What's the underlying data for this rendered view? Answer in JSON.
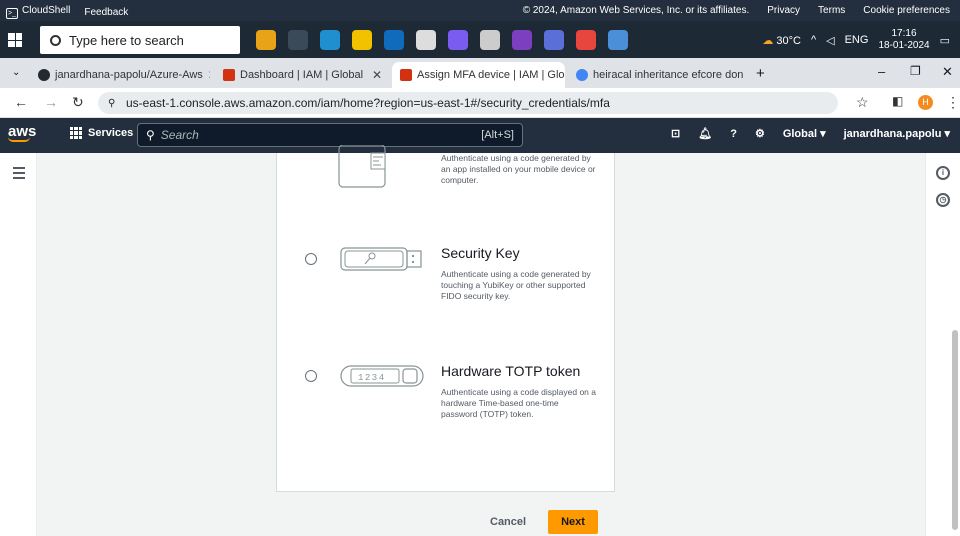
{
  "aws_footer": {
    "cloudshell": "CloudShell",
    "feedback": "Feedback",
    "copyright": "© 2024, Amazon Web Services, Inc. or its affiliates.",
    "privacy": "Privacy",
    "terms": "Terms",
    "cookie": "Cookie preferences"
  },
  "taskbar": {
    "search_placeholder": "Type here to search",
    "weather": "30°C",
    "lang": "ENG",
    "time": "17:16",
    "date": "18-01-2024"
  },
  "tabs": [
    {
      "label": "janardhana-papolu/Azure-Aws",
      "color": "#24292f"
    },
    {
      "label": "Dashboard | IAM | Global",
      "color": "#d13212"
    },
    {
      "label": "Assign MFA device | IAM | Glob",
      "color": "#d13212"
    },
    {
      "label": "heiracal inheritance efcore don",
      "color": "#4285f4"
    }
  ],
  "browser": {
    "url": "us-east-1.console.aws.amazon.com/iam/home?region=us-east-1#/security_credentials/mfa",
    "profile_initial": "H"
  },
  "aws_nav": {
    "logo": "aws",
    "services": "Services",
    "search_placeholder": "Search",
    "shortcut": "[Alt+S]",
    "region": "Global ▾",
    "account": "janardhana.papolu ▾"
  },
  "mfa_options": [
    {
      "title": "",
      "description": "Authenticate using a code generated by an app installed on your mobile device or computer.",
      "icon": "mobile-app-icon"
    },
    {
      "title": "Security Key",
      "description": "Authenticate using a code generated by touching a YubiKey or other supported FIDO security key.",
      "icon": "security-key-icon"
    },
    {
      "title": "Hardware TOTP token",
      "description": "Authenticate using a code displayed on a hardware Time-based one-time password (TOTP) token.",
      "icon": "totp-token-icon",
      "token_display": "1234"
    }
  ],
  "actions": {
    "cancel": "Cancel",
    "next": "Next"
  },
  "colors": {
    "aws_nav": "#232f3e",
    "primary_button": "#ff9900"
  }
}
